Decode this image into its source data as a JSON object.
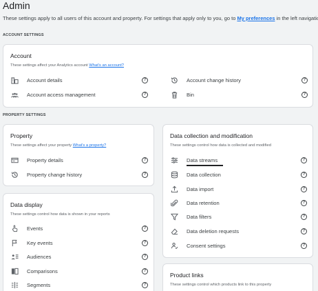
{
  "page": {
    "title": "Admin",
    "intro_before": "These settings apply to all users of this account and property. For settings that apply only to you, go to ",
    "intro_link": "My preferences",
    "intro_after": " in the left navigation."
  },
  "account_settings": {
    "section_label": "ACCOUNT SETTINGS",
    "card_title": "Account",
    "subtitle": "These settings affect your Analytics account ",
    "subtitle_link": "What's an account?",
    "items": [
      {
        "label": "Account details",
        "icon": "account-details-icon"
      },
      {
        "label": "Account access management",
        "icon": "people-icon"
      },
      {
        "label": "Account change history",
        "icon": "history-icon"
      },
      {
        "label": "Bin",
        "icon": "trash-icon"
      }
    ]
  },
  "property_settings": {
    "section_label": "PROPERTY SETTINGS",
    "property": {
      "card_title": "Property",
      "subtitle": "These settings affect your property ",
      "subtitle_link": "What's a property?",
      "items": [
        {
          "label": "Property details",
          "icon": "card-icon"
        },
        {
          "label": "Property change history",
          "icon": "history-icon"
        }
      ]
    },
    "data_display": {
      "card_title": "Data display",
      "subtitle": "These settings control how data is shown in your reports",
      "items": [
        {
          "label": "Events",
          "icon": "hand-pointer-icon"
        },
        {
          "label": "Key events",
          "icon": "flag-icon"
        },
        {
          "label": "Audiences",
          "icon": "audience-icon"
        },
        {
          "label": "Comparisons",
          "icon": "compare-icon"
        },
        {
          "label": "Segments",
          "icon": "segments-icon"
        }
      ]
    },
    "data_collection": {
      "card_title": "Data collection and modification",
      "subtitle": "These settings control how data is collected and modified",
      "active_item": "Data streams",
      "items": [
        {
          "label": "Data streams",
          "icon": "streams-icon"
        },
        {
          "label": "Data collection",
          "icon": "database-icon"
        },
        {
          "label": "Data import",
          "icon": "upload-icon"
        },
        {
          "label": "Data retention",
          "icon": "paperclip-icon"
        },
        {
          "label": "Data filters",
          "icon": "filter-icon"
        },
        {
          "label": "Data deletion requests",
          "icon": "eraser-icon"
        },
        {
          "label": "Consent settings",
          "icon": "consent-icon"
        }
      ]
    },
    "product_links": {
      "card_title": "Product links",
      "subtitle": "These settings control which products link to this property"
    }
  },
  "help_glyph": "?"
}
